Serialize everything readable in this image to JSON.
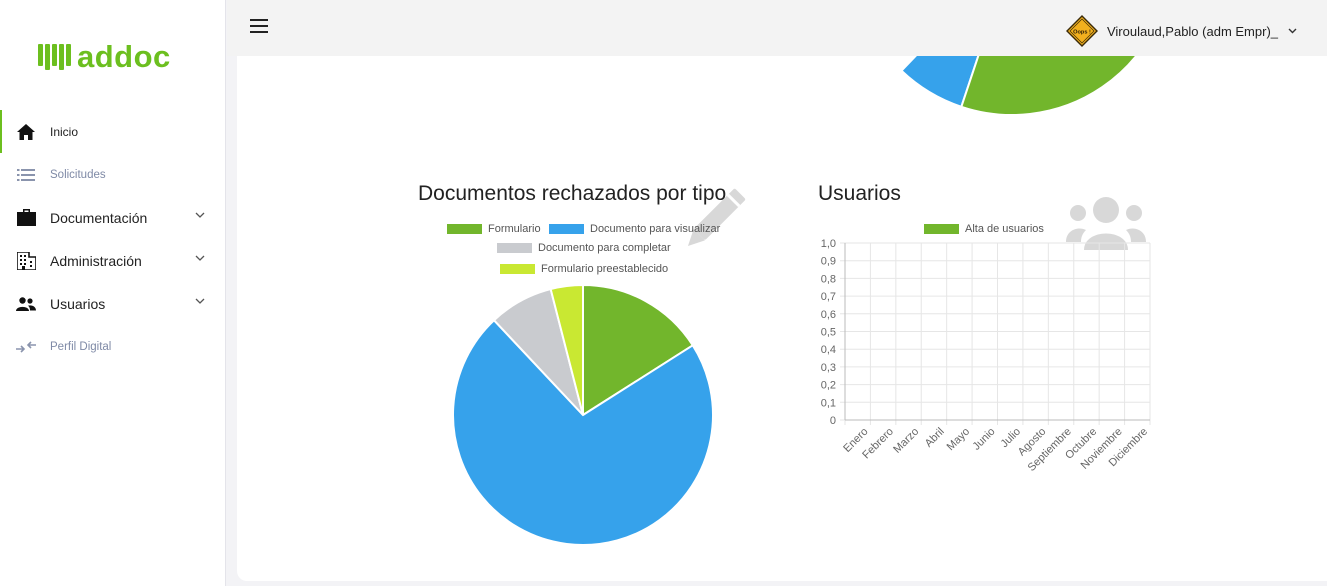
{
  "app": {
    "logo_text": "addoc"
  },
  "sidebar": {
    "items": [
      {
        "label": "Inicio",
        "icon": "home-icon"
      },
      {
        "label": "Solicitudes",
        "icon": "list-icon"
      },
      {
        "label": "Documentación",
        "icon": "briefcase-icon"
      },
      {
        "label": "Administración",
        "icon": "building-icon"
      },
      {
        "label": "Usuarios",
        "icon": "users-icon"
      },
      {
        "label": "Perfil Digital",
        "icon": "arrows-icon"
      }
    ]
  },
  "header": {
    "menu_icon": "hamburger-icon",
    "user_name": "Viroulaud,Pablo (adm Empr)_",
    "avatar_text": "Oops !"
  },
  "colors": {
    "brand": "#6cbf1f",
    "series_green": "#72b62c",
    "series_blue": "#36a2eb",
    "series_gray": "#c9cbcf",
    "series_lime": "#c9e832"
  },
  "chart_data": [
    {
      "type": "pie",
      "title": "",
      "series": [
        {
          "name": "",
          "value": 0.11,
          "color": "#36a2eb"
        },
        {
          "name": "",
          "value": 0.89,
          "color": "#72b62c"
        }
      ],
      "note_partial": true
    },
    {
      "type": "pie",
      "title": "Documentos rechazados por tipo",
      "legend": [
        "Formulario",
        "Documento para visualizar",
        "Documento para completar",
        "Formulario preestablecido"
      ],
      "legend_position": "top",
      "series": [
        {
          "name": "Formulario",
          "value": 16,
          "color": "#72b62c"
        },
        {
          "name": "Documento para visualizar",
          "value": 72,
          "color": "#36a2eb"
        },
        {
          "name": "Documento para completar",
          "value": 8,
          "color": "#c9cbcf"
        },
        {
          "name": "Formulario preestablecido",
          "value": 4,
          "color": "#c9e832"
        }
      ],
      "watermark_icon": "pencil-icon"
    },
    {
      "type": "line",
      "title": "Usuarios",
      "legend": [
        "Alta de usuarios"
      ],
      "legend_position": "top",
      "categories": [
        "Enero",
        "Febrero",
        "Marzo",
        "Abril",
        "Mayo",
        "Junio",
        "Julio",
        "Agosto",
        "Septiembre",
        "Octubre",
        "Noviembre",
        "Diciembre"
      ],
      "series": [
        {
          "name": "Alta de usuarios",
          "values": [],
          "color": "#72b62c"
        }
      ],
      "ylim": [
        0,
        1
      ],
      "yticks": [
        "0",
        "0,1",
        "0,2",
        "0,3",
        "0,4",
        "0,5",
        "0,6",
        "0,7",
        "0,8",
        "0,9",
        "1,0"
      ],
      "grid": true,
      "watermark_icon": "users-group-icon"
    }
  ]
}
